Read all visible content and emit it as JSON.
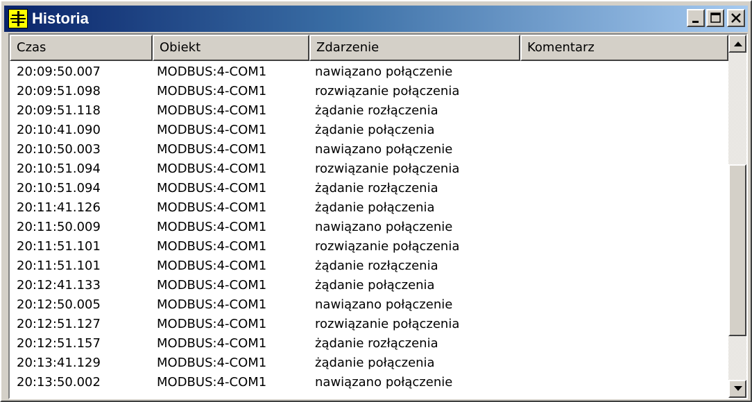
{
  "window": {
    "title": "Historia"
  },
  "columns": [
    "Czas",
    "Obiekt",
    "Zdarzenie",
    "Komentarz"
  ],
  "rows": [
    {
      "time": "20:09:50.007",
      "object": "MODBUS:4-COM1",
      "event": "nawiązano połączenie",
      "comment": ""
    },
    {
      "time": "20:09:51.098",
      "object": "MODBUS:4-COM1",
      "event": "rozwiązanie połączenia",
      "comment": ""
    },
    {
      "time": "20:09:51.118",
      "object": "MODBUS:4-COM1",
      "event": "żądanie rozłączenia",
      "comment": ""
    },
    {
      "time": "20:10:41.090",
      "object": "MODBUS:4-COM1",
      "event": "żądanie połączenia",
      "comment": ""
    },
    {
      "time": "20:10:50.003",
      "object": "MODBUS:4-COM1",
      "event": "nawiązano połączenie",
      "comment": ""
    },
    {
      "time": "20:10:51.094",
      "object": "MODBUS:4-COM1",
      "event": "rozwiązanie połączenia",
      "comment": ""
    },
    {
      "time": "20:10:51.094",
      "object": "MODBUS:4-COM1",
      "event": "żądanie rozłączenia",
      "comment": ""
    },
    {
      "time": "20:11:41.126",
      "object": "MODBUS:4-COM1",
      "event": "żądanie połączenia",
      "comment": ""
    },
    {
      "time": "20:11:50.009",
      "object": "MODBUS:4-COM1",
      "event": "nawiązano połączenie",
      "comment": ""
    },
    {
      "time": "20:11:51.101",
      "object": "MODBUS:4-COM1",
      "event": "rozwiązanie połączenia",
      "comment": ""
    },
    {
      "time": "20:11:51.101",
      "object": "MODBUS:4-COM1",
      "event": "żądanie rozłączenia",
      "comment": ""
    },
    {
      "time": "20:12:41.133",
      "object": "MODBUS:4-COM1",
      "event": "żądanie połączenia",
      "comment": ""
    },
    {
      "time": "20:12:50.005",
      "object": "MODBUS:4-COM1",
      "event": "nawiązano połączenie",
      "comment": ""
    },
    {
      "time": "20:12:51.127",
      "object": "MODBUS:4-COM1",
      "event": "rozwiązanie połączenia",
      "comment": ""
    },
    {
      "time": "20:12:51.157",
      "object": "MODBUS:4-COM1",
      "event": "żądanie rozłączenia",
      "comment": ""
    },
    {
      "time": "20:13:41.129",
      "object": "MODBUS:4-COM1",
      "event": "żądanie połączenia",
      "comment": ""
    },
    {
      "time": "20:13:50.002",
      "object": "MODBUS:4-COM1",
      "event": "nawiązano połączenie",
      "comment": ""
    }
  ],
  "scroll_position": 0.72,
  "icons": {
    "app": "app-logo-icon",
    "minimize": "minimize-icon",
    "maximize": "maximize-icon",
    "close": "close-icon",
    "scroll_up": "arrow-up-icon",
    "scroll_down": "arrow-down-icon"
  },
  "colors": {
    "title_gradient_start": "#0a246a",
    "title_gradient_end": "#a6caf0",
    "app_icon": "#ffff00",
    "face": "#d4d0c8"
  }
}
